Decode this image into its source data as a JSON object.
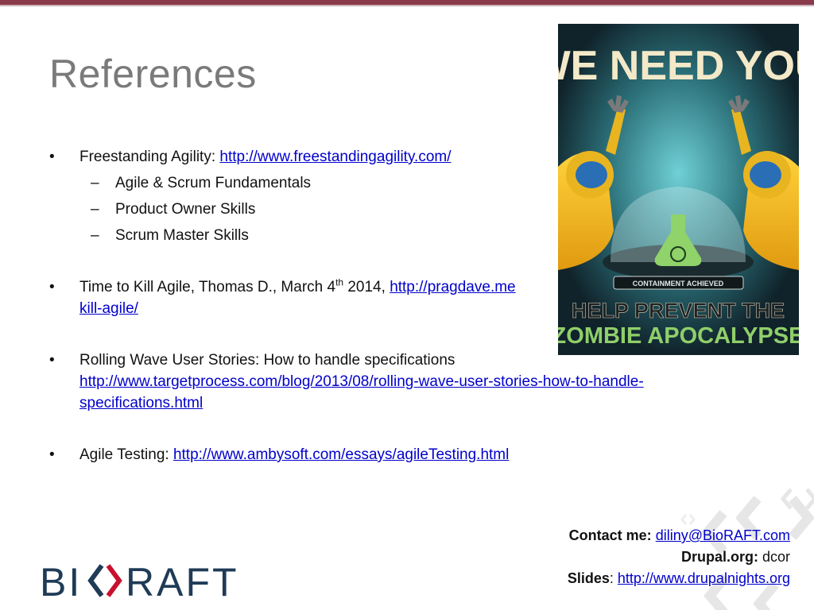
{
  "slide": {
    "title": "References"
  },
  "references": [
    {
      "text": "Freestanding Agility: ",
      "link": "http://www.freestandingagility.com/",
      "sub_items": [
        "Agile & Scrum Fundamentals",
        "Product Owner Skills",
        "Scrum Master Skills"
      ]
    },
    {
      "text_before_sup": "Time to Kill Agile, Thomas D., March 4",
      "sup": "th",
      "text_after_sup": " 2014, ",
      "link_line1": "http://pragdave.me",
      "link_line2": "kill-agile/"
    },
    {
      "text": "Rolling Wave User Stories: How to handle specifications",
      "link_line1": "http://www.targetprocess.com/blog/2013/08/rolling-wave-user-stories-how-to-handle-",
      "link_line2": "specifications.html"
    },
    {
      "text": "Agile Testing: ",
      "link": "http://www.ambysoft.com/essays/agileTesting.html"
    }
  ],
  "poster": {
    "headline": "WE NEED YOU",
    "badge": "CONTAINMENT ACHIEVED",
    "line1": "HELP PREVENT THE",
    "line2": "ZOMBIE APOCALYPSE"
  },
  "contact": {
    "contact_label": "Contact me:",
    "email": "diliny@BioRAFT.com",
    "drupal_label": "Drupal.org:",
    "drupal_value": "dcor",
    "slides_label": "Slides",
    "slides_sep": ":",
    "slides_link": "http://www.drupalnights.org"
  },
  "logo": {
    "text_left": "BI",
    "text_right": "RAFT"
  },
  "colors": {
    "accent": "#8a3a4a",
    "link": "#0000cc",
    "logo_dark": "#1f3b56",
    "logo_red": "#c8102e",
    "title_gray": "#7a7a7a"
  }
}
